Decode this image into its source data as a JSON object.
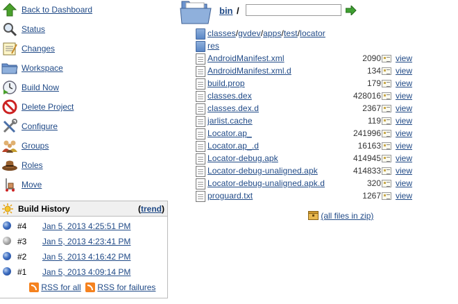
{
  "nav": [
    {
      "label": "Back to Dashboard",
      "icon": "up-arrow-icon"
    },
    {
      "label": "Status",
      "icon": "magnifier-icon"
    },
    {
      "label": "Changes",
      "icon": "notepad-icon"
    },
    {
      "label": "Workspace",
      "icon": "folder-icon"
    },
    {
      "label": "Build Now",
      "icon": "clock-icon"
    },
    {
      "label": "Delete Project",
      "icon": "no-entry-icon"
    },
    {
      "label": "Configure",
      "icon": "tools-icon"
    },
    {
      "label": "Groups",
      "icon": "people-icon"
    },
    {
      "label": "Roles",
      "icon": "hat-icon"
    },
    {
      "label": "Move",
      "icon": "hand-truck-icon"
    }
  ],
  "build_history": {
    "title": "Build History",
    "trend_label": "trend",
    "builds": [
      {
        "number": "#4",
        "date": "Jan 5, 2013 4:25:51 PM",
        "status": "blue"
      },
      {
        "number": "#3",
        "date": "Jan 5, 2013 4:23:41 PM",
        "status": "grey"
      },
      {
        "number": "#2",
        "date": "Jan 5, 2013 4:16:42 PM",
        "status": "blue"
      },
      {
        "number": "#1",
        "date": "Jan 5, 2013 4:09:14 PM",
        "status": "blue"
      }
    ],
    "rss_all": "RSS for all",
    "rss_failures": "RSS for failures"
  },
  "path": {
    "current": "bin",
    "separator": "/",
    "input_value": ""
  },
  "entries": [
    {
      "type": "folder",
      "parts": [
        "classes",
        "gvdev",
        "apps",
        "test",
        "locator"
      ]
    },
    {
      "type": "folder",
      "name": "res"
    },
    {
      "type": "file",
      "name": "AndroidManifest.xml",
      "size": "2090"
    },
    {
      "type": "file",
      "name": "AndroidManifest.xml.d",
      "size": "134"
    },
    {
      "type": "file",
      "name": "build.prop",
      "size": "179"
    },
    {
      "type": "file",
      "name": "classes.dex",
      "size": "428016"
    },
    {
      "type": "file",
      "name": "classes.dex.d",
      "size": "2367"
    },
    {
      "type": "file",
      "name": "jarlist.cache",
      "size": "119"
    },
    {
      "type": "file",
      "name": "Locator.ap_",
      "size": "241996"
    },
    {
      "type": "file",
      "name": "Locator.ap_.d",
      "size": "16163"
    },
    {
      "type": "file",
      "name": "Locator-debug.apk",
      "size": "414945"
    },
    {
      "type": "file",
      "name": "Locator-debug-unaligned.apk",
      "size": "414833"
    },
    {
      "type": "file",
      "name": "Locator-debug-unaligned.apk.d",
      "size": "320"
    },
    {
      "type": "file",
      "name": "proguard.txt",
      "size": "1267"
    }
  ],
  "view_label": "view",
  "zip_label": "(all files in zip)"
}
